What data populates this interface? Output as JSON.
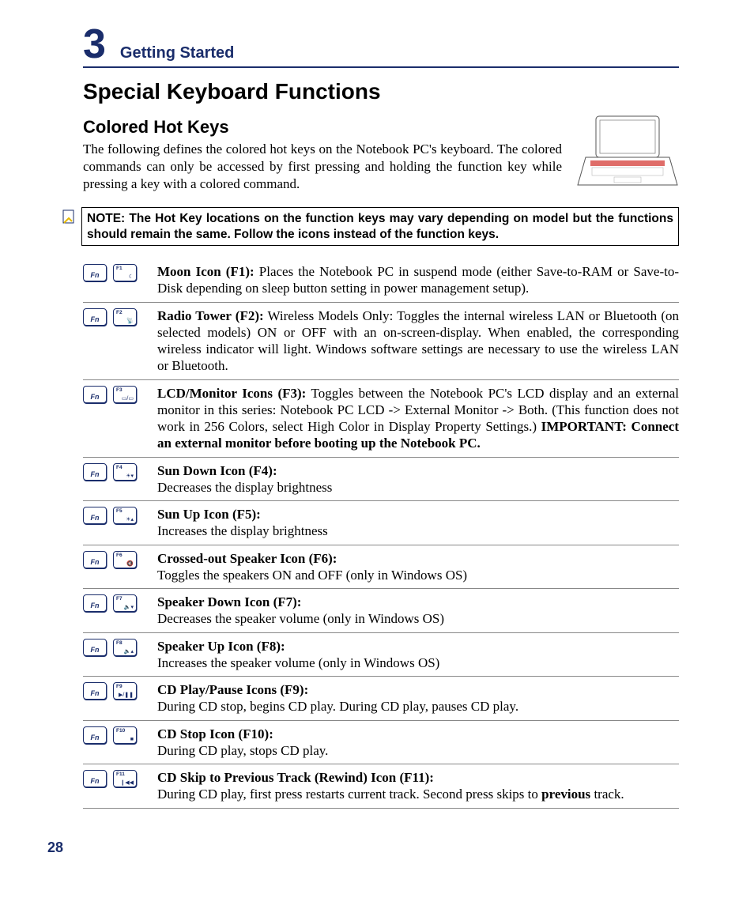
{
  "chapter": {
    "num": "3",
    "title": "Getting Started"
  },
  "section_title": "Special Keyboard Functions",
  "sub_title": "Colored Hot Keys",
  "intro": "The following defines the colored hot keys on the Notebook PC's keyboard. The colored commands can only be accessed by first pressing and holding the function key while pressing a key with a colored command.",
  "note": "NOTE: The Hot Key locations on the function keys may vary depending on model but the functions should remain the same. Follow the icons instead of the function keys.",
  "fn_label": "Fn",
  "hotkeys": [
    {
      "f": "F1",
      "glyph": "☾",
      "title": "Moon Icon (F1):",
      "body": " Places the Notebook PC in suspend mode (either Save-to-RAM or Save-to-Disk depending on sleep button setting in power management setup).",
      "bold_tail": ""
    },
    {
      "f": "F2",
      "glyph": "📡",
      "title": "Radio Tower (F2):",
      "body": " Wireless Models Only: Toggles the internal wireless LAN or Bluetooth (on selected models) ON or OFF with an on-screen-display. When enabled, the corresponding wireless indicator will light. Windows software settings are necessary to use the wireless LAN or Bluetooth.",
      "bold_tail": ""
    },
    {
      "f": "F3",
      "glyph": "▭/▭",
      "title": "LCD/Monitor Icons (F3):",
      "body": " Toggles between the Notebook PC's LCD display and an external monitor in this series: Notebook PC LCD -> External Monitor -> Both. (This function does not work in 256 Colors, select High Color in Display Property Settings.) ",
      "bold_tail": "IMPORTANT: Connect an external monitor before booting up the Notebook PC."
    },
    {
      "f": "F4",
      "glyph": "☀▾",
      "title": "Sun Down Icon (F4):",
      "body": "\nDecreases the display brightness",
      "bold_tail": ""
    },
    {
      "f": "F5",
      "glyph": "☀▴",
      "title": "Sun Up Icon (F5):",
      "body": "\nIncreases the display brightness",
      "bold_tail": ""
    },
    {
      "f": "F6",
      "glyph": "🔇",
      "title": "Crossed-out Speaker Icon (F6):",
      "body": "\nToggles the speakers ON and OFF (only in Windows OS)",
      "bold_tail": ""
    },
    {
      "f": "F7",
      "glyph": "🔈▾",
      "title": "Speaker Down Icon (F7):",
      "body": "\nDecreases the speaker volume (only in Windows OS)",
      "bold_tail": ""
    },
    {
      "f": "F8",
      "glyph": "🔈▴",
      "title": "Speaker Up Icon (F8):",
      "body": "\nIncreases the speaker volume (only in Windows OS)",
      "bold_tail": ""
    },
    {
      "f": "F9",
      "glyph": "▶/❚❚",
      "title": "CD Play/Pause Icons (F9):",
      "body": "\nDuring CD stop, begins CD play. During CD play, pauses CD play.",
      "bold_tail": ""
    },
    {
      "f": "F10",
      "glyph": "■",
      "title": "CD Stop Icon (F10):",
      "body": "\nDuring CD play, stops CD play.",
      "bold_tail": ""
    },
    {
      "f": "F11",
      "glyph": "❙◀◀",
      "title": "CD Skip to Previous Track (Rewind) Icon (F11):",
      "body_pre": "\nDuring CD play, first press restarts current track. Second press skips to ",
      "body_bold": "previous",
      "body_post": " track.",
      "bold_tail": ""
    }
  ],
  "page_num": "28"
}
